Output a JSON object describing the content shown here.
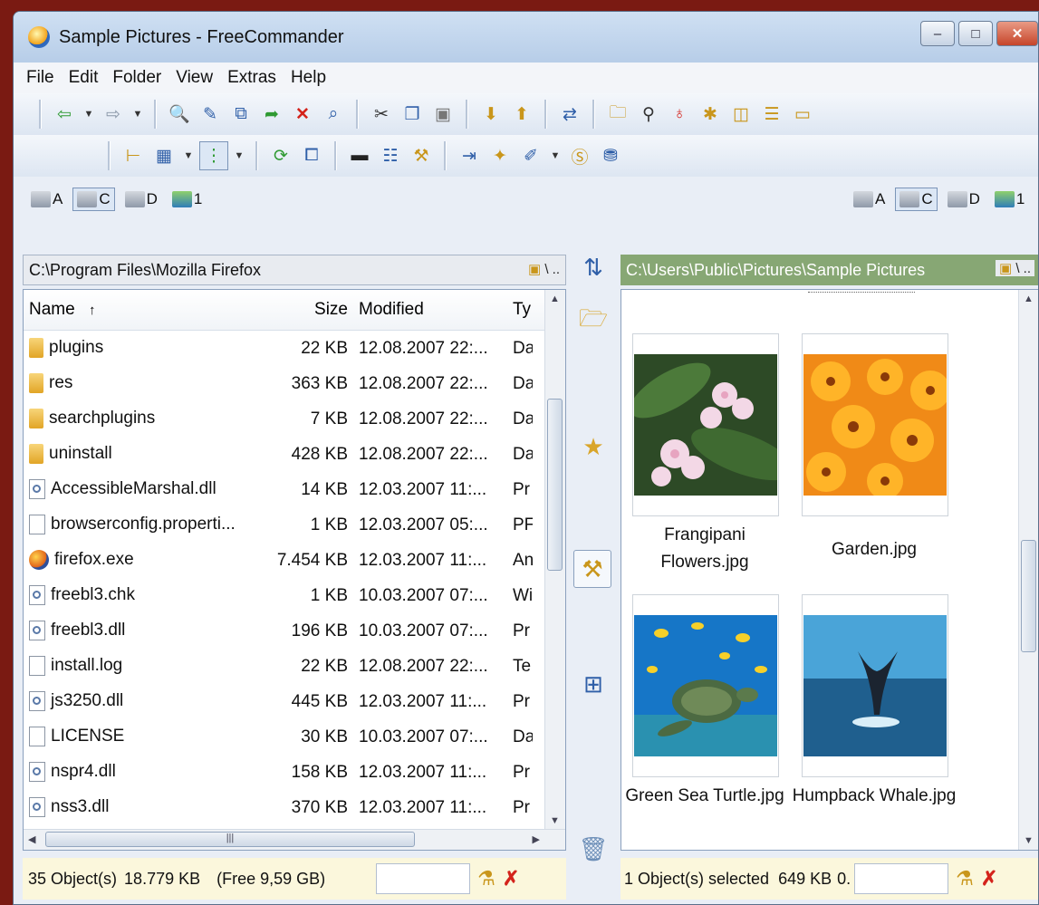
{
  "window": {
    "title": "Sample Pictures - FreeCommander",
    "minimize": "–",
    "maximize": "□",
    "close": "✕"
  },
  "menu": [
    "File",
    "Edit",
    "Folder",
    "View",
    "Extras",
    "Help"
  ],
  "drives": [
    {
      "letter": "A",
      "icon": "floppy-drive-icon"
    },
    {
      "letter": "C",
      "icon": "hard-drive-icon",
      "active": true
    },
    {
      "letter": "D",
      "icon": "cd-drive-icon"
    },
    {
      "letter": "1",
      "icon": "network-drive-icon"
    }
  ],
  "left_panel": {
    "path": "C:\\Program Files\\Mozilla Firefox",
    "path_tools": "\\ ..",
    "columns": {
      "name": "Name",
      "sort_arrow": "↑",
      "size": "Size",
      "modified": "Modified",
      "type": "Ty"
    },
    "files": [
      {
        "name": "plugins",
        "size": "22 KB",
        "modified": "12.08.2007 22:...",
        "type": "Da",
        "icon": "folder"
      },
      {
        "name": "res",
        "size": "363 KB",
        "modified": "12.08.2007 22:...",
        "type": "Da",
        "icon": "folder"
      },
      {
        "name": "searchplugins",
        "size": "7 KB",
        "modified": "12.08.2007 22:...",
        "type": "Da",
        "icon": "folder"
      },
      {
        "name": "uninstall",
        "size": "428 KB",
        "modified": "12.08.2007 22:...",
        "type": "Da",
        "icon": "folder"
      },
      {
        "name": "AccessibleMarshal.dll",
        "size": "14 KB",
        "modified": "12.03.2007 11:...",
        "type": "Pr",
        "icon": "dll"
      },
      {
        "name": "browserconfig.properti...",
        "size": "1 KB",
        "modified": "12.03.2007 05:...",
        "type": "PF",
        "icon": "file"
      },
      {
        "name": "firefox.exe",
        "size": "7.454 KB",
        "modified": "12.03.2007 11:...",
        "type": "An",
        "icon": "exe"
      },
      {
        "name": "freebl3.chk",
        "size": "1 KB",
        "modified": "10.03.2007 07:...",
        "type": "Wi",
        "icon": "dll"
      },
      {
        "name": "freebl3.dll",
        "size": "196 KB",
        "modified": "10.03.2007 07:...",
        "type": "Pr",
        "icon": "dll"
      },
      {
        "name": "install.log",
        "size": "22 KB",
        "modified": "12.08.2007 22:...",
        "type": "Te",
        "icon": "file"
      },
      {
        "name": "js3250.dll",
        "size": "445 KB",
        "modified": "12.03.2007 11:...",
        "type": "Pr",
        "icon": "dll"
      },
      {
        "name": "LICENSE",
        "size": "30 KB",
        "modified": "10.03.2007 07:...",
        "type": "Da",
        "icon": "file"
      },
      {
        "name": "nspr4.dll",
        "size": "158 KB",
        "modified": "12.03.2007 11:...",
        "type": "Pr",
        "icon": "dll"
      },
      {
        "name": "nss3.dll",
        "size": "370 KB",
        "modified": "12.03.2007 11:...",
        "type": "Pr",
        "icon": "dll"
      }
    ],
    "status": {
      "objects": "35 Object(s)",
      "total": "18.779 KB",
      "free": "(Free 9,59 GB)"
    }
  },
  "right_panel": {
    "path": "C:\\Users\\Public\\Pictures\\Sample Pictures",
    "path_tools": "\\ ..",
    "thumbnails": [
      {
        "label": "Frangipani Flowers.jpg",
        "image": "frangipani-flowers"
      },
      {
        "label": "Garden.jpg",
        "image": "orange-garden-flowers"
      },
      {
        "label": "Green Sea Turtle.jpg",
        "image": "sea-turtle"
      },
      {
        "label": "Humpback Whale.jpg",
        "image": "whale-tail"
      }
    ],
    "status": {
      "selected": "1 Object(s) selected",
      "size": "649 KB",
      "more": "0."
    }
  },
  "colors": {
    "title_gradient_top": "#cfe0f3",
    "right_path_bg": "#87a774",
    "status_bg": "#fbf7dc",
    "background": "#7a1a12"
  }
}
